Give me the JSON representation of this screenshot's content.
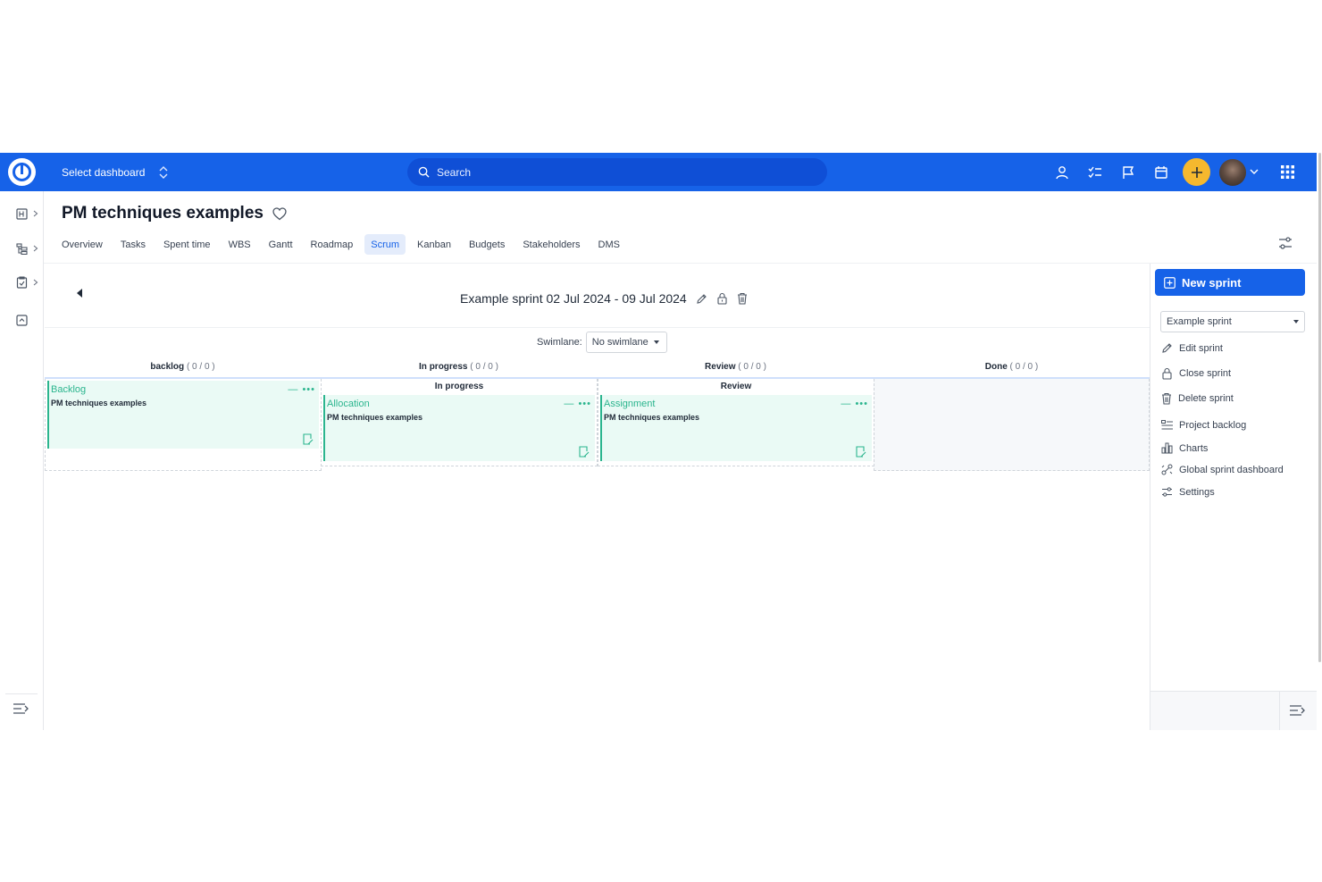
{
  "topbar": {
    "dashboard_label": "Select dashboard",
    "search_placeholder": "Search"
  },
  "page": {
    "title": "PM techniques examples",
    "tabs": [
      {
        "label": "Overview",
        "active": false
      },
      {
        "label": "Tasks",
        "active": false
      },
      {
        "label": "Spent time",
        "active": false
      },
      {
        "label": "WBS",
        "active": false
      },
      {
        "label": "Gantt",
        "active": false
      },
      {
        "label": "Roadmap",
        "active": false
      },
      {
        "label": "Scrum",
        "active": true
      },
      {
        "label": "Kanban",
        "active": false
      },
      {
        "label": "Budgets",
        "active": false
      },
      {
        "label": "Stakeholders",
        "active": false
      },
      {
        "label": "DMS",
        "active": false
      }
    ]
  },
  "sprint": {
    "title": "Example sprint 02 Jul 2024 - 09 Jul 2024",
    "swimlane_label": "Swimlane:",
    "swimlane_value": "No swimlane"
  },
  "columns": [
    {
      "name": "backlog",
      "count": "( 0 / 0 )"
    },
    {
      "name": "In progress",
      "count": "( 0 / 0 )"
    },
    {
      "name": "Review",
      "count": "( 0 / 0 )"
    },
    {
      "name": "Done",
      "count": "( 0 / 0 )"
    }
  ],
  "lanes": {
    "in_progress_title": "In progress",
    "review_title": "Review"
  },
  "cards": [
    {
      "name": "Backlog",
      "project": "PM techniques examples",
      "controls": "— •••"
    },
    {
      "name": "Allocation",
      "project": "PM techniques examples",
      "controls": "— •••"
    },
    {
      "name": "Assignment",
      "project": "PM techniques examples",
      "controls": "— •••"
    }
  ],
  "sidebar": {
    "new_sprint": "New sprint",
    "sprint_select": "Example sprint",
    "actions": [
      {
        "label": "Edit sprint",
        "icon": "pencil-icon"
      },
      {
        "label": "Close sprint",
        "icon": "lock-icon"
      },
      {
        "label": "Delete sprint",
        "icon": "trash-icon"
      }
    ],
    "links": [
      {
        "label": "Project backlog",
        "icon": "backlog-icon"
      },
      {
        "label": "Charts",
        "icon": "bar-chart-icon"
      },
      {
        "label": "Global sprint dashboard",
        "icon": "dashboard-icon"
      },
      {
        "label": "Settings",
        "icon": "sliders-icon"
      }
    ]
  },
  "colors": {
    "brand": "#1662e8",
    "accent_plus": "#f5b82e",
    "card_green": "#2bb58e",
    "card_bg": "#eafaf5"
  }
}
